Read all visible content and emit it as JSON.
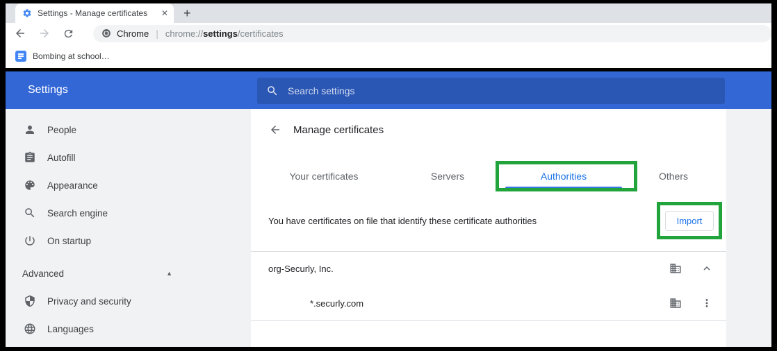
{
  "colors": {
    "strip-gray": "#DEE1E6",
    "omnibox-gray": "#F1F3F4",
    "page-gray": "#F1F2F4",
    "header-blue": "#3367D6",
    "search-blue": "#2A56B4",
    "accent-green": "#22A43C",
    "link-blue": "#1A73E8",
    "tab-underline": "#3B78E8",
    "icon-gray": "#5F6368",
    "disabled-gray": "#BDC1C6",
    "text-dark": "#202124",
    "text-mid": "#3C4043",
    "text-gray": "#80868B",
    "divider": "#DADCE0",
    "bookmark-blue": "#4285F4",
    "favicon-blue": "#4285F4"
  },
  "browser": {
    "tab_title": "Settings - Manage certificates",
    "site_label": "Chrome",
    "url": {
      "scheme": "chrome://",
      "host": "settings",
      "path": "/certificates"
    },
    "bookmark_label": "Bombing at school…"
  },
  "icons": {
    "close": "✕",
    "new_tab": "+",
    "url_divider": "|",
    "collapse_caret": "▲"
  },
  "header": {
    "title": "Settings",
    "search_placeholder": "Search settings"
  },
  "sidebar": {
    "items": [
      {
        "label": "People"
      },
      {
        "label": "Autofill"
      },
      {
        "label": "Appearance"
      },
      {
        "label": "Search engine"
      },
      {
        "label": "On startup"
      }
    ],
    "advanced_label": "Advanced",
    "advanced_items": [
      {
        "label": "Privacy and security"
      },
      {
        "label": "Languages"
      }
    ]
  },
  "content": {
    "title": "Manage certificates",
    "tabs": [
      {
        "label": "Your certificates",
        "active": false
      },
      {
        "label": "Servers",
        "active": false
      },
      {
        "label": "Authorities",
        "active": true
      },
      {
        "label": "Others",
        "active": false
      }
    ],
    "description": "You have certificates on file that identify these certificate authorities",
    "import_button": "Import",
    "certificate_groups": [
      {
        "name": "org-Securly, Inc.",
        "expanded": true,
        "children": [
          {
            "name": "*.securly.com"
          }
        ]
      }
    ]
  }
}
